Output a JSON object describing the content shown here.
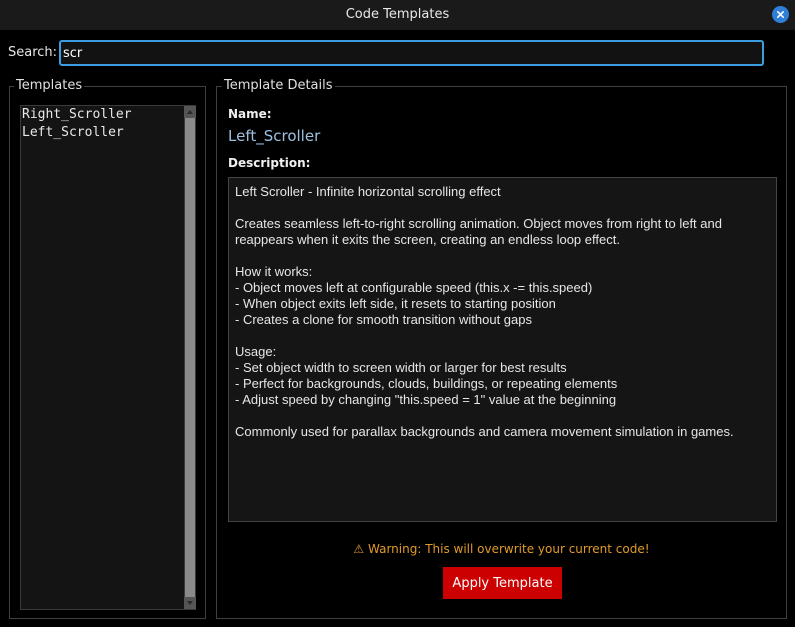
{
  "window": {
    "title": "Code Templates"
  },
  "search": {
    "label": "Search:",
    "value": "scr"
  },
  "templates": {
    "label": "Templates",
    "items": [
      "Right_Scroller",
      "Left_Scroller"
    ]
  },
  "details": {
    "label": "Template Details",
    "name_label": "Name:",
    "name_value": "Left_Scroller",
    "description_label": "Description:",
    "description": "Left Scroller - Infinite horizontal scrolling effect\n\nCreates seamless left-to-right scrolling animation. Object moves from right to left and reappears when it exits the screen, creating an endless loop effect.\n\nHow it works:\n- Object moves left at configurable speed (this.x -= this.speed)\n- When object exits left side, it resets to starting position\n- Creates a clone for smooth transition without gaps\n\nUsage:\n- Set object width to screen width or larger for best results\n- Perfect for backgrounds, clouds, buildings, or repeating elements\n- Adjust speed by changing \"this.speed = 1\" value at the beginning\n\nCommonly used for parallax backgrounds and camera movement simulation in games.",
    "warning": "⚠ Warning: This will overwrite your current code!",
    "apply_label": "Apply Template"
  },
  "colors": {
    "accent": "#3c9de0",
    "apply_button": "#cc0000",
    "warning": "#e09a2a",
    "name_value": "#9ec0e0"
  },
  "icons": {
    "close": "close-icon",
    "scroll_up": "scroll-up-arrow-icon",
    "scroll_down": "scroll-down-arrow-icon"
  }
}
